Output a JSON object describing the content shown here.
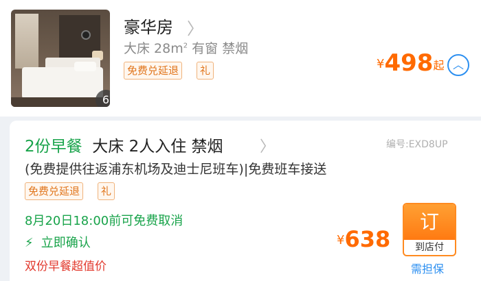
{
  "room": {
    "photo_count": "6",
    "title": "豪华房",
    "chevron": "〉",
    "desc_main": "大床 28m",
    "desc_sup": "2",
    "desc_rest": " 有窗 禁烟",
    "tags": [
      "免费兑延退",
      "礼"
    ],
    "price_symbol": "¥",
    "price": "498",
    "price_suffix": "起",
    "expand_icon": "︿"
  },
  "plan": {
    "breakfast": "2份早餐",
    "details": "大床  2人入住  禁烟",
    "chevron": "〉",
    "code": "编号:EXD8UP",
    "shuttle": "(免费提供往返浦东机场及迪士尼班车)|免费班车接送",
    "tags": [
      "免费兑延退",
      "礼"
    ],
    "cancel": "8月20日18:00前可免费取消",
    "confirm_icon": "⚡",
    "confirm": "立即确认",
    "promo": "双份早餐超值价",
    "price_symbol": "¥",
    "price": "638",
    "book_label": "订",
    "pay_label": "到店付",
    "guarantee": "需担保"
  },
  "colors": {
    "accent_orange": "#ff6a00",
    "green": "#18a34a",
    "blue": "#2c8ff0",
    "red": "#e23a2e"
  }
}
